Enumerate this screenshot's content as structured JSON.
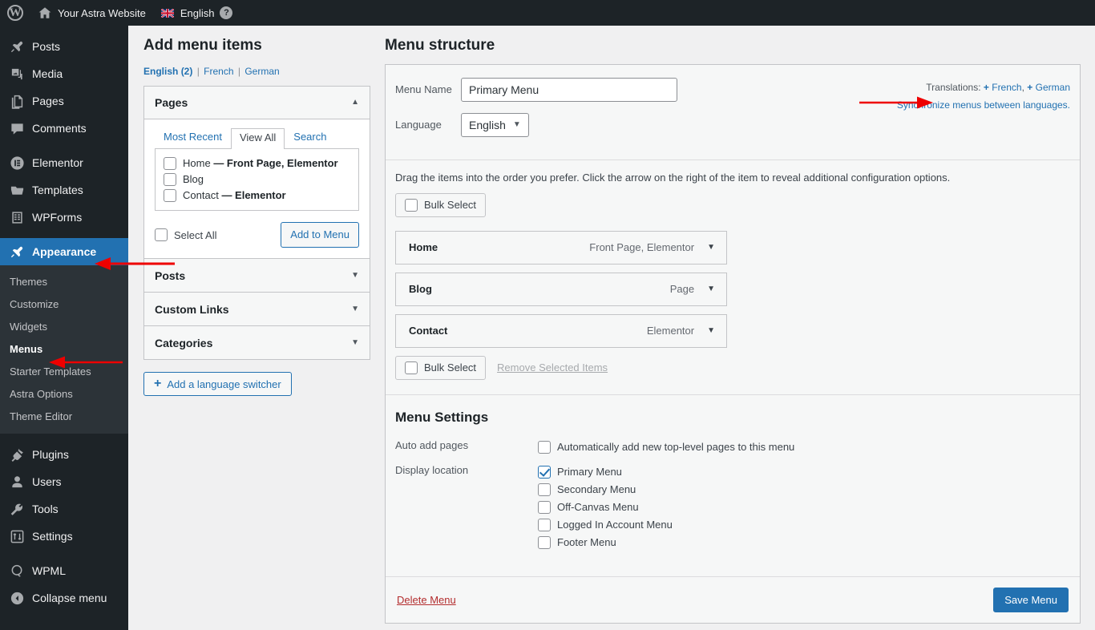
{
  "adminbar": {
    "logo_icon": "wordpress-logo-icon",
    "home_icon": "home-icon",
    "site_title": "Your Astra Website",
    "flag_icon": "uk-flag-icon",
    "language": "English",
    "help_icon": "help-icon"
  },
  "sidebar": {
    "items": [
      {
        "label": "Posts",
        "icon": "pin-icon"
      },
      {
        "label": "Media",
        "icon": "media-icon"
      },
      {
        "label": "Pages",
        "icon": "pages-icon"
      },
      {
        "label": "Comments",
        "icon": "comments-icon"
      },
      {
        "label": "Elementor",
        "icon": "elementor-icon"
      },
      {
        "label": "Templates",
        "icon": "folder-icon"
      },
      {
        "label": "WPForms",
        "icon": "wpforms-icon"
      },
      {
        "label": "Appearance",
        "icon": "brush-icon"
      },
      {
        "label": "Plugins",
        "icon": "plugin-icon"
      },
      {
        "label": "Users",
        "icon": "user-icon"
      },
      {
        "label": "Tools",
        "icon": "wrench-icon"
      },
      {
        "label": "Settings",
        "icon": "settings-icon"
      },
      {
        "label": "WPML",
        "icon": "wpml-icon"
      },
      {
        "label": "Collapse menu",
        "icon": "collapse-icon"
      }
    ],
    "submenu": [
      "Themes",
      "Customize",
      "Widgets",
      "Menus",
      "Starter Templates",
      "Astra Options",
      "Theme Editor"
    ],
    "active_item": "Appearance",
    "active_submenu": "Menus"
  },
  "add_menu_items": {
    "heading": "Add menu items",
    "lang_current": "English",
    "lang_current_count": "(2)",
    "lang_french": "French",
    "lang_german": "German",
    "separator": "|",
    "pages_panel": {
      "title": "Pages",
      "collapse_icon": "triangle-up-icon",
      "tabs": [
        {
          "label": "Most Recent",
          "active": false
        },
        {
          "label": "View All",
          "active": true
        },
        {
          "label": "Search",
          "active": false
        }
      ],
      "items": [
        {
          "name": "Home",
          "meta": "— Front Page, Elementor",
          "checked": false
        },
        {
          "name": "Blog",
          "meta": "",
          "checked": false
        },
        {
          "name": "Contact",
          "meta": "— Elementor",
          "checked": false
        }
      ],
      "select_all": "Select All",
      "add_button": "Add to Menu"
    },
    "collapsed_panels": [
      {
        "title": "Posts",
        "icon": "triangle-down-icon"
      },
      {
        "title": "Custom Links",
        "icon": "triangle-down-icon"
      },
      {
        "title": "Categories",
        "icon": "triangle-down-icon"
      }
    ],
    "language_switcher_button": "Add a language switcher"
  },
  "menu_structure": {
    "heading": "Menu structure",
    "menu_name_label": "Menu Name",
    "menu_name_value": "Primary Menu",
    "language_label": "Language",
    "language_value": "English",
    "translations_label": "Translations:",
    "translations": [
      {
        "plus": "+",
        "label": "French"
      },
      {
        "plus": "+",
        "label": "German"
      }
    ],
    "translations_separator": ",",
    "sync_link": "Synchronize menus between languages.",
    "drag_hint": "Drag the items into the order you prefer. Click the arrow on the right of the item to reveal additional configuration options.",
    "bulk_select_top": "Bulk Select",
    "bulk_select_bottom": "Bulk Select",
    "remove_selected": "Remove Selected Items",
    "rows": [
      {
        "title": "Home",
        "type": "Front Page, Elementor",
        "icon": "triangle-down-icon"
      },
      {
        "title": "Blog",
        "type": "Page",
        "icon": "triangle-down-icon"
      },
      {
        "title": "Contact",
        "type": "Elementor",
        "icon": "triangle-down-icon"
      }
    ]
  },
  "menu_settings": {
    "title": "Menu Settings",
    "auto_add_label": "Auto add pages",
    "auto_add_option": "Automatically add new top-level pages to this menu",
    "auto_add_checked": false,
    "display_location_label": "Display location",
    "locations": [
      {
        "label": "Primary Menu",
        "checked": true
      },
      {
        "label": "Secondary Menu",
        "checked": false
      },
      {
        "label": "Off-Canvas Menu",
        "checked": false
      },
      {
        "label": "Logged In Account Menu",
        "checked": false
      },
      {
        "label": "Footer Menu",
        "checked": false
      }
    ]
  },
  "footer": {
    "delete_label": "Delete Menu",
    "save_label": "Save Menu"
  },
  "colors": {
    "admin_bar": "#1d2327",
    "sidebar": "#1d2327",
    "accent_blue": "#2271b1",
    "annotation_red": "#ee0000",
    "delete_red": "#b32d2e",
    "content_bg": "#f0f0f1"
  }
}
